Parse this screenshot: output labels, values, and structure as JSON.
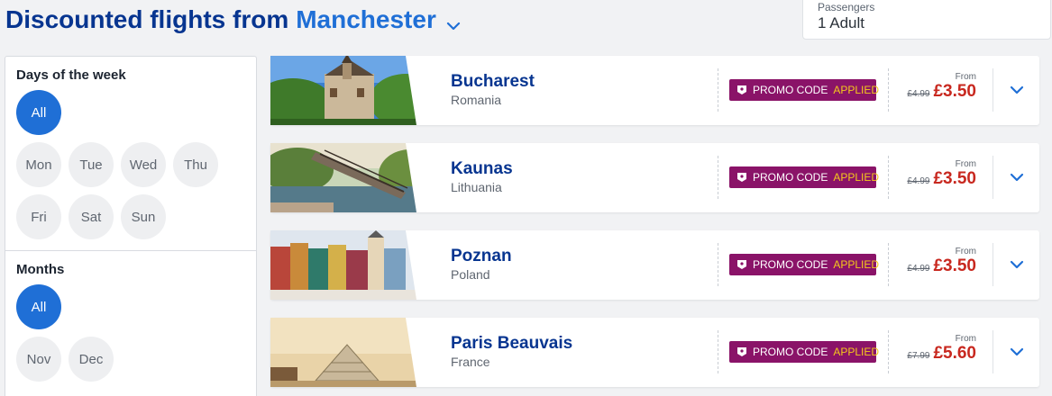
{
  "header": {
    "title_prefix": "Discounted flights from",
    "origin_city": "Manchester"
  },
  "passengers": {
    "label": "Passengers",
    "value": "1 Adult"
  },
  "filters": {
    "days": {
      "heading": "Days of the week",
      "items": [
        {
          "label": "All",
          "active": true
        },
        {
          "label": "Mon",
          "active": false
        },
        {
          "label": "Tue",
          "active": false
        },
        {
          "label": "Wed",
          "active": false
        },
        {
          "label": "Thu",
          "active": false
        },
        {
          "label": "Fri",
          "active": false
        },
        {
          "label": "Sat",
          "active": false
        },
        {
          "label": "Sun",
          "active": false
        }
      ]
    },
    "months": {
      "heading": "Months",
      "items": [
        {
          "label": "All",
          "active": true
        },
        {
          "label": "Nov",
          "active": false
        },
        {
          "label": "Dec",
          "active": false
        }
      ]
    }
  },
  "flights": [
    {
      "city": "Bucharest",
      "country": "Romania",
      "promo_label": "PROMO CODE",
      "promo_status": "APPLIED",
      "from_label": "From",
      "old_price": "£4.99",
      "price": "£3.50"
    },
    {
      "city": "Kaunas",
      "country": "Lithuania",
      "promo_label": "PROMO CODE",
      "promo_status": "APPLIED",
      "from_label": "From",
      "old_price": "£4.99",
      "price": "£3.50"
    },
    {
      "city": "Poznan",
      "country": "Poland",
      "promo_label": "PROMO CODE",
      "promo_status": "APPLIED",
      "from_label": "From",
      "old_price": "£4.99",
      "price": "£3.50"
    },
    {
      "city": "Paris Beauvais",
      "country": "France",
      "promo_label": "PROMO CODE",
      "promo_status": "APPLIED",
      "from_label": "From",
      "old_price": "£7.99",
      "price": "£5.60"
    }
  ],
  "colors": {
    "brand_navy": "#073590",
    "accent_blue": "#1f6fd6",
    "promo_purple": "#8a1368",
    "promo_yellow": "#f4c81c",
    "price_red": "#c8281f"
  },
  "icons": {
    "title_dropdown": "chevron-down-icon",
    "promo": "tag-icon",
    "expand": "chevron-down-icon"
  }
}
